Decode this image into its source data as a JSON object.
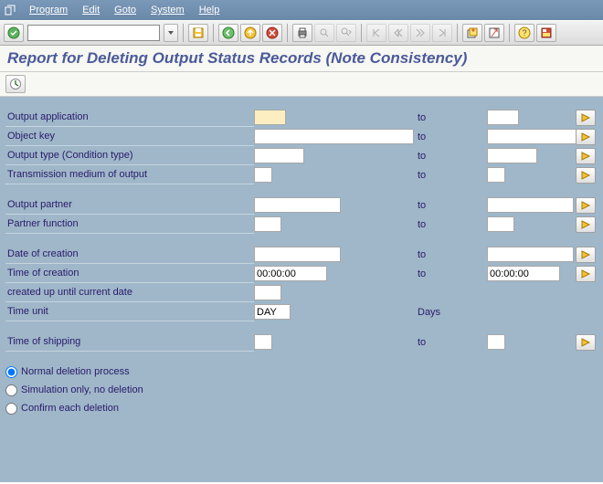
{
  "menu": {
    "items": [
      "Program",
      "Edit",
      "Goto",
      "System",
      "Help"
    ]
  },
  "commandField": {
    "value": ""
  },
  "title": "Report for Deleting Output Status Records (Note Consistency)",
  "fields": {
    "output_application": {
      "label": "Output application",
      "to": "to"
    },
    "object_key": {
      "label": "Object key",
      "to": "to"
    },
    "output_type": {
      "label": "Output type (Condition type)",
      "to": "to"
    },
    "transmission": {
      "label": "Transmission medium of output",
      "to": "to"
    },
    "output_partner": {
      "label": "Output partner",
      "to": "to"
    },
    "partner_function": {
      "label": "Partner function",
      "to": "to"
    },
    "date_creation": {
      "label": "Date of creation",
      "to": "to"
    },
    "time_creation": {
      "label": "Time of creation",
      "from_value": "00:00:00",
      "to": "to",
      "to_value": "00:00:00"
    },
    "created_until": {
      "label": "created up until current date"
    },
    "time_unit": {
      "label": "Time unit",
      "value": "DAY",
      "days_label": "Days"
    },
    "time_shipping": {
      "label": "Time of shipping",
      "to": "to"
    }
  },
  "radios": {
    "normal": "Normal deletion process",
    "sim": "Simulation only, no deletion",
    "confirm": "Confirm each deletion"
  }
}
